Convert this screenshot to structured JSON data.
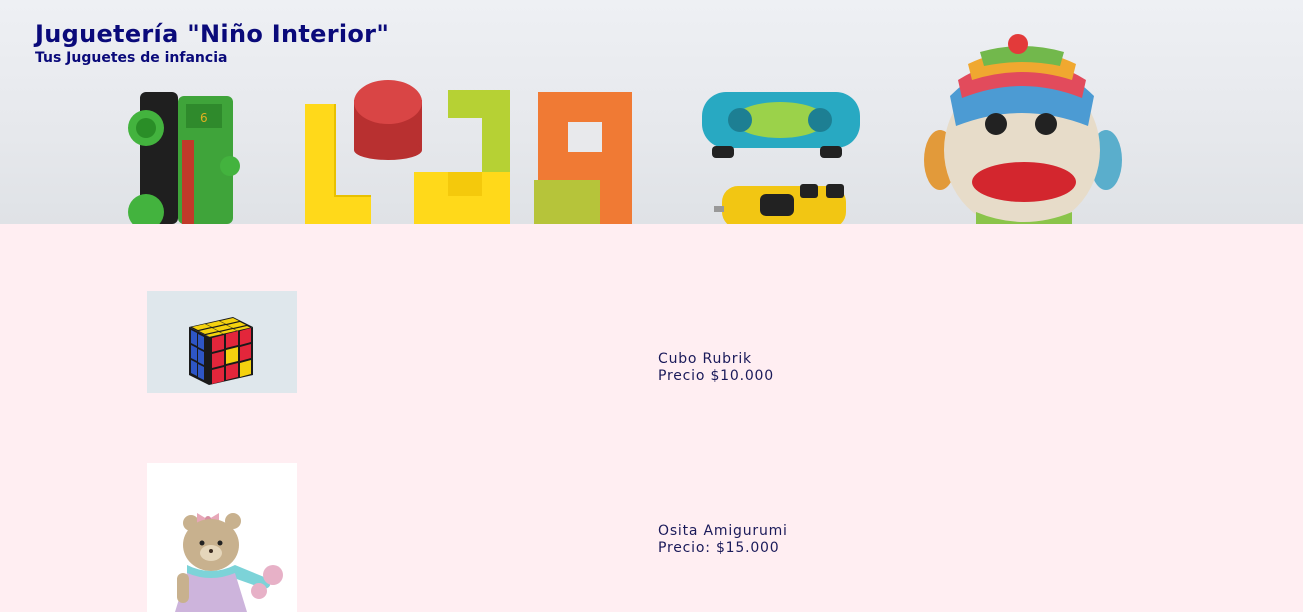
{
  "header": {
    "title": "Juguetería \"Niño Interior\"",
    "subtitle": "Tus Juguetes de infancia"
  },
  "products": [
    {
      "name": "Cubo Rubrik",
      "price": "Precio $10.000",
      "icon": "rubiks-cube-icon"
    },
    {
      "name": "Osita Amigurumi",
      "price": "Precio: $15.000",
      "icon": "amigurumi-bear-icon"
    }
  ],
  "colors": {
    "page_background": "#ffeef2",
    "title_color": "#0a0a7a",
    "text_color": "#1a1a5a"
  }
}
